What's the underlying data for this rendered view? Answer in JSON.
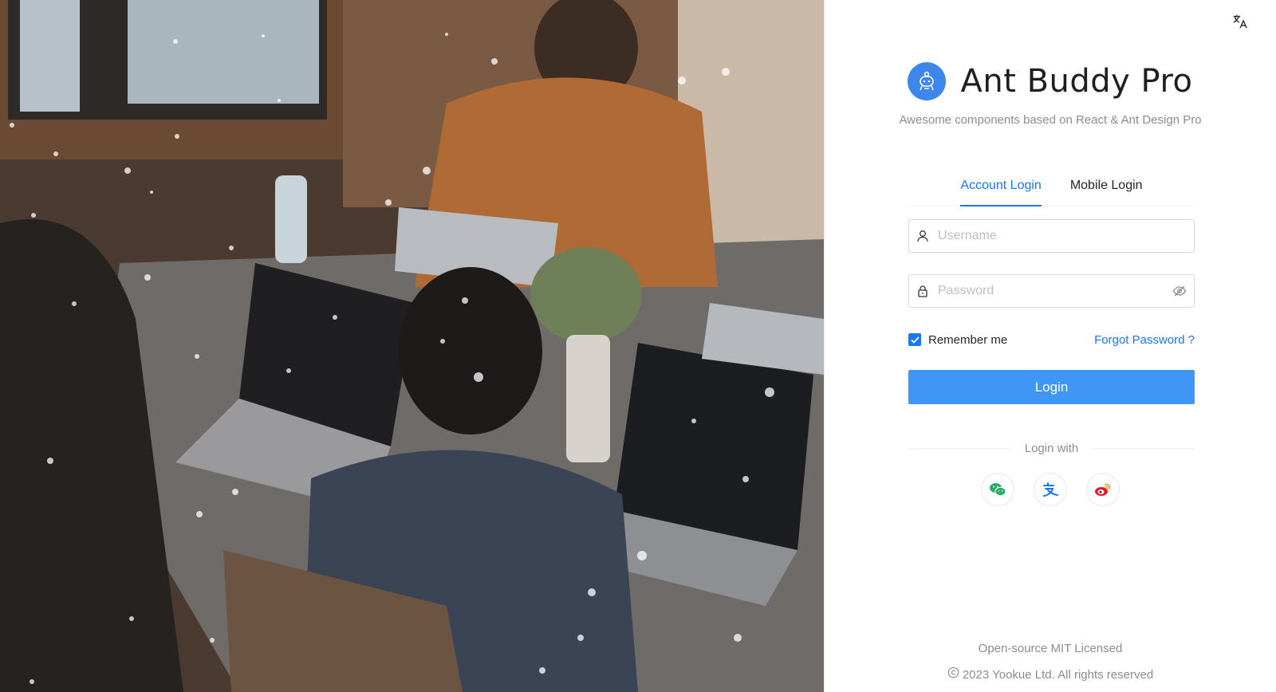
{
  "photo": {
    "description_icon": "office-photo"
  },
  "header": {
    "language_icon": "translate-icon"
  },
  "brand": {
    "logo_icon": "buddy-robot-icon",
    "title": "Ant Buddy Pro",
    "subtitle": "Awesome components based on React & Ant Design Pro",
    "accent_color": "#1677ff"
  },
  "tabs": [
    {
      "label": "Account Login",
      "active": true
    },
    {
      "label": "Mobile Login",
      "active": false
    }
  ],
  "form": {
    "username": {
      "placeholder": "Username",
      "value": "",
      "icon": "user-icon"
    },
    "password": {
      "placeholder": "Password",
      "value": "",
      "icon": "lock-icon",
      "toggle_icon": "eye-invisible-icon"
    },
    "remember": {
      "label": "Remember me",
      "checked": true
    },
    "forgot_label": "Forgot Password ?",
    "submit_label": "Login"
  },
  "social": {
    "divider_label": "Login with",
    "providers": [
      {
        "name": "WeChat",
        "icon": "wechat-icon",
        "color": "#2aae67"
      },
      {
        "name": "Alipay",
        "icon": "alipay-icon",
        "color": "#1677ff"
      },
      {
        "name": "Weibo",
        "icon": "weibo-icon",
        "color": "#e6162d"
      }
    ]
  },
  "footer": {
    "license": "Open-source MIT Licensed",
    "copyright": "2023 Yookue Ltd. All rights reserved"
  }
}
